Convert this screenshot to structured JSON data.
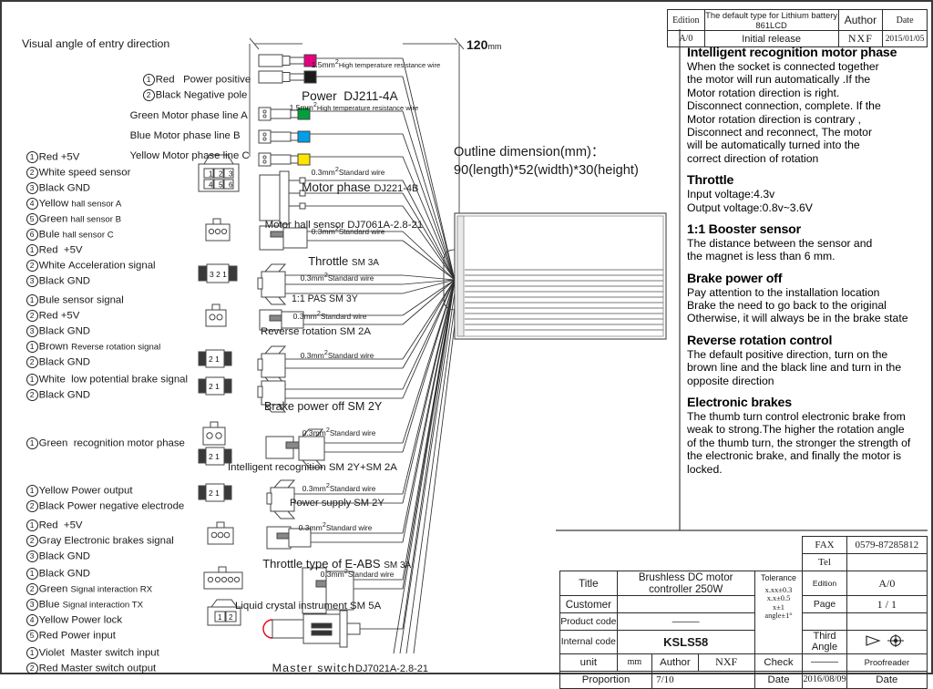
{
  "header_table": {
    "col_labels": [
      "Edition",
      "The default type for Lithium battery 861LCD",
      "Author",
      "Date"
    ],
    "row": [
      "A/0",
      "Initial release",
      "NXF",
      "2015/01/05"
    ]
  },
  "notes": [
    {
      "title": "Intelligent recognition motor phase",
      "lines": [
        "When the socket is connected together",
        "the motor will run automatically .If the",
        "Motor rotation direction is right.",
        "Disconnect connection, complete. If the",
        "Motor rotation direction  is contrary ,",
        "Disconnect and reconnect, The motor",
        "will be automatically turned into the",
        "correct direction of rotation"
      ]
    },
    {
      "title": "Throttle",
      "lines": [
        "Input voltage:4.3v",
        "Output voltage:0.8v~3.6V"
      ]
    },
    {
      "title": "1:1 Booster sensor",
      "lines": [
        "The distance between the sensor and",
        " the magnet is less than 6 mm."
      ]
    },
    {
      "title": "Brake power off",
      "lines": [
        "Pay attention to the installation location",
        "Brake the need to go back to the original",
        "Otherwise, it will always be in the brake state"
      ]
    },
    {
      "title": "Reverse rotation control",
      "lines": [
        "The default positive direction, turn on the",
        "brown line and the black line and turn in the",
        "opposite direction"
      ]
    },
    {
      "title": "Electronic brakes",
      "lines": [
        "The thumb turn control electronic brake from",
        "weak to strong.The higher the rotation angle",
        "of the thumb turn, the stronger the strength of",
        " the electronic brake, and finally the motor is",
        " locked."
      ]
    }
  ],
  "diagram": {
    "visual_angle": "Visual angle of entry direction",
    "dimension_120": "120",
    "dimension_120_unit": "mm",
    "outline_line1": "Outline dimension(mm)：",
    "outline_line2": "90(length)*52(width)*30(height)"
  },
  "wire_groups": [
    {
      "id": "power",
      "items": [
        {
          "n": "1",
          "color": "Red",
          "desc": "Power positive"
        },
        {
          "n": "2",
          "color": "Black",
          "desc": "Negative pole"
        }
      ]
    },
    {
      "id": "phase",
      "items": [
        {
          "n": "",
          "color": "Green",
          "desc": "Motor phase line A"
        },
        {
          "n": "",
          "color": "Blue",
          "desc": "Motor phase line B"
        },
        {
          "n": "",
          "color": "Yellow",
          "desc": "Motor phase line C"
        }
      ]
    },
    {
      "id": "hall",
      "items": [
        {
          "n": "1",
          "color": "Red",
          "desc": "+5V"
        },
        {
          "n": "2",
          "color": "White",
          "desc": "speed sensor"
        },
        {
          "n": "3",
          "color": "Black",
          "desc": "GND"
        },
        {
          "n": "4",
          "color": "Yellow",
          "desc": "hall sensor A"
        },
        {
          "n": "5",
          "color": "Green",
          "desc": "hall sensor B"
        },
        {
          "n": "6",
          "color": "Bule",
          "desc": "hall sensor C"
        }
      ]
    },
    {
      "id": "throttle",
      "items": [
        {
          "n": "1",
          "color": "Red",
          "desc": "+5V"
        },
        {
          "n": "2",
          "color": "White",
          "desc": "Acceleration signal"
        },
        {
          "n": "3",
          "color": "Black",
          "desc": "GND"
        }
      ]
    },
    {
      "id": "pas",
      "items": [
        {
          "n": "1",
          "color": "Bule",
          "desc": "sensor signal"
        },
        {
          "n": "2",
          "color": "Red",
          "desc": "+5V"
        },
        {
          "n": "3",
          "color": "Black",
          "desc": "GND"
        }
      ]
    },
    {
      "id": "reverse",
      "items": [
        {
          "n": "1",
          "color": "Brown",
          "desc": "Reverse rotation signal"
        },
        {
          "n": "2",
          "color": "Black",
          "desc": "GND"
        }
      ]
    },
    {
      "id": "brake",
      "items": [
        {
          "n": "1",
          "color": "White",
          "desc": "low potential brake signal"
        },
        {
          "n": "2",
          "color": "Black",
          "desc": "GND"
        }
      ]
    },
    {
      "id": "recognition",
      "items": [
        {
          "n": "1",
          "color": "Green",
          "desc": "recognition motor phase"
        }
      ]
    },
    {
      "id": "supply",
      "items": [
        {
          "n": "1",
          "color": "Yellow",
          "desc": "Power output"
        },
        {
          "n": "2",
          "color": "Black",
          "desc": "Power negative electrode"
        }
      ]
    },
    {
      "id": "eabs",
      "items": [
        {
          "n": "1",
          "color": "Red",
          "desc": "+5V"
        },
        {
          "n": "2",
          "color": "Gray",
          "desc": "Electronic brakes signal"
        },
        {
          "n": "3",
          "color": "Black",
          "desc": "GND"
        }
      ]
    },
    {
      "id": "lcd",
      "items": [
        {
          "n": "1",
          "color": "Black",
          "desc": "GND"
        },
        {
          "n": "2",
          "color": "Green",
          "desc": "Signal interaction RX"
        },
        {
          "n": "3",
          "color": "Blue",
          "desc": "Signal interaction TX"
        },
        {
          "n": "4",
          "color": "Yellow",
          "desc": "Power lock"
        },
        {
          "n": "5",
          "color": "Red",
          "desc": "Power input"
        }
      ]
    },
    {
      "id": "master",
      "items": [
        {
          "n": "1",
          "color": "Violet",
          "desc": "Master switch input"
        },
        {
          "n": "2",
          "color": "Red",
          "desc": "Master switch output"
        }
      ]
    }
  ],
  "connector_labels": [
    {
      "id": "power",
      "name": "Power",
      "code": "DJ211-4A",
      "wire": "1.5mm",
      "sup": "2",
      "wire2": "High temperature resistance wire"
    },
    {
      "id": "phase",
      "name": "Motor phase",
      "code": "DJ221-4B",
      "wire": "1.5mm",
      "sup": "2",
      "wire2": "High temperature resistance wire"
    },
    {
      "id": "hall",
      "name": "Motor hall sensor",
      "code": "DJ7061A-2.8-21",
      "wire": "0.3mm",
      "sup": "2",
      "wire2": "Standard wire"
    },
    {
      "id": "throttle",
      "name": "Throttle",
      "code": "SM 3A",
      "wire": "0.3mm",
      "sup": "2",
      "wire2": "Standard wire"
    },
    {
      "id": "pas",
      "name": "1:1 PAS SM 3Y",
      "code": "",
      "wire": "0.3mm",
      "sup": "2",
      "wire2": "Standard wire"
    },
    {
      "id": "reverse",
      "name": "Reverse rotation SM 2A",
      "code": "",
      "wire": "0.3mm",
      "sup": "2",
      "wire2": "Standard wire"
    },
    {
      "id": "brake",
      "name": "Brake power off SM 2Y",
      "code": "",
      "wire": "0.3mm",
      "sup": "2",
      "wire2": "Standard wire"
    },
    {
      "id": "recognition",
      "name": "Intelligent recognition SM 2Y+SM 2A",
      "code": "",
      "wire": "0.3mm",
      "sup": "2",
      "wire2": "Standard wire"
    },
    {
      "id": "supply",
      "name": "Power supply SM 2Y",
      "code": "",
      "wire": "0.3mm",
      "sup": "2",
      "wire2": "Standard wire"
    },
    {
      "id": "eabs",
      "name": "Throttle type of E-ABS",
      "code": "SM 3A",
      "wire": "0.3mm",
      "sup": "2",
      "wire2": "Standard wire"
    },
    {
      "id": "lcd",
      "name": "Liquid crystal instrument SM 5A",
      "code": "",
      "wire": "0.3mm",
      "sup": "2",
      "wire2": "Standard wire"
    },
    {
      "id": "master",
      "name": "Master switch",
      "code": "DJ7021A-2.8-21",
      "wire": "",
      "sup": "",
      "wire2": ""
    }
  ],
  "title_block": {
    "fax_label": "FAX",
    "fax_value": "0579-87285812",
    "tel_label": "Tel",
    "tel_value": "",
    "title_label": "Title",
    "title_value": "Brushless DC motor controller 250W",
    "tolerance_label": "Tolerance",
    "edition_label": "Edition",
    "edition_value": "A/0",
    "customer_label": "Customer",
    "customer_value": "",
    "page_label": "Page",
    "page_value": "1 / 1",
    "product_code_label": "Product code",
    "product_code_value": "———",
    "internal_code_label": "Internal code",
    "internal_code_value": "KSLS58",
    "tolerance_lines": [
      "x.xx±0.3",
      "x.x±0.5",
      "x±1",
      "angle±1°"
    ],
    "third_angle_label": "Third\nAngle",
    "unit_label": "unit",
    "unit_value": "mm",
    "author_label": "Author",
    "author_value": "NXF",
    "check_label": "Check",
    "check_value": "———",
    "proofreader_label": "Proofreader",
    "proofreader_value": "",
    "proportion_label": "Proportion",
    "proportion_value": "7/10",
    "date_label": "Date",
    "date_value": "2016/08/09",
    "date2_label": "Date",
    "date2_value": ""
  },
  "colors": {
    "magenta": "#e6007e",
    "black": "#1a1a1a",
    "green": "#00a03c",
    "blue": "#00a0e9",
    "yellow": "#ffe400",
    "red": "#e60012",
    "line": "#555555",
    "border": "#3a3a3a"
  }
}
